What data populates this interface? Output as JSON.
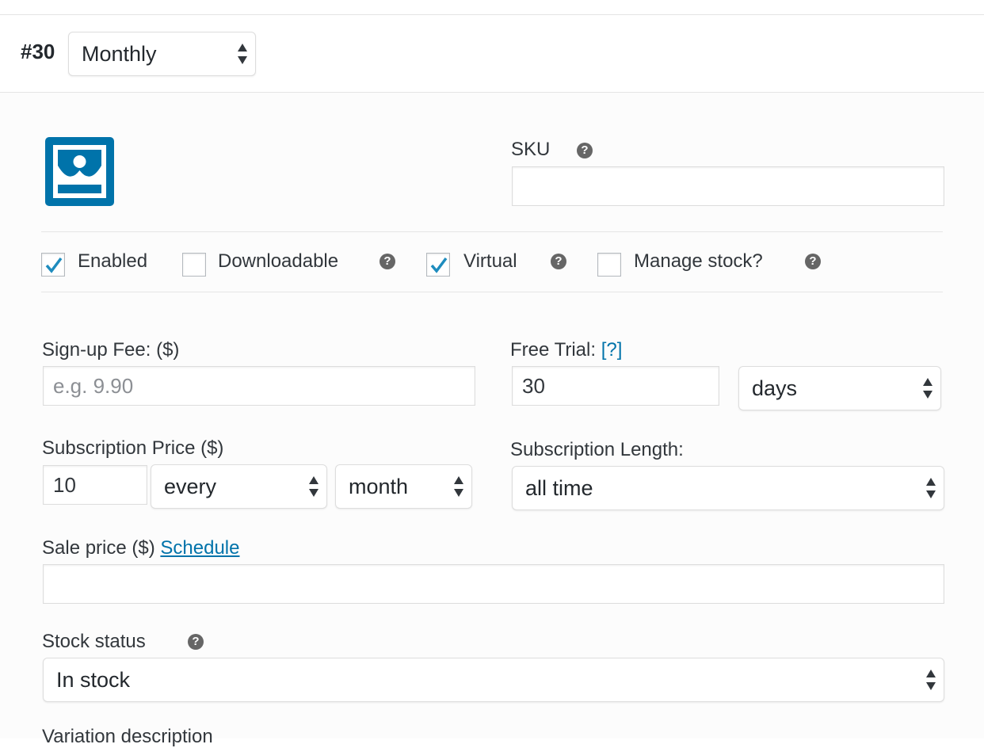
{
  "variation": {
    "id_label": "#30",
    "attribute_value": "Monthly"
  },
  "sku": {
    "label": "SKU",
    "help_icon": "question-circle-icon",
    "value": ""
  },
  "checkboxes": {
    "enabled": {
      "label": "Enabled",
      "checked": true
    },
    "downloadable": {
      "label": "Downloadable",
      "checked": false
    },
    "virtual": {
      "label": "Virtual",
      "checked": true
    },
    "manage_stock": {
      "label": "Manage stock?",
      "checked": false
    }
  },
  "signup_fee": {
    "label": "Sign-up Fee: ($)",
    "placeholder": "e.g. 9.90",
    "value": ""
  },
  "free_trial": {
    "label": "Free Trial:",
    "help_link": "[?]",
    "value": "30",
    "period": "days"
  },
  "subscription_price": {
    "label": "Subscription Price ($)",
    "value": "10",
    "interval": "every",
    "period": "month"
  },
  "subscription_length": {
    "label": "Subscription Length:",
    "value": "all time"
  },
  "sale_price": {
    "label": "Sale price ($)",
    "schedule_link": "Schedule",
    "value": ""
  },
  "stock_status": {
    "label": "Stock status",
    "value": "In stock"
  },
  "variation_description": {
    "label": "Variation description"
  },
  "colors": {
    "accent": "#0073aa",
    "image_icon": "#0073aa",
    "help_icon": "#666666"
  }
}
